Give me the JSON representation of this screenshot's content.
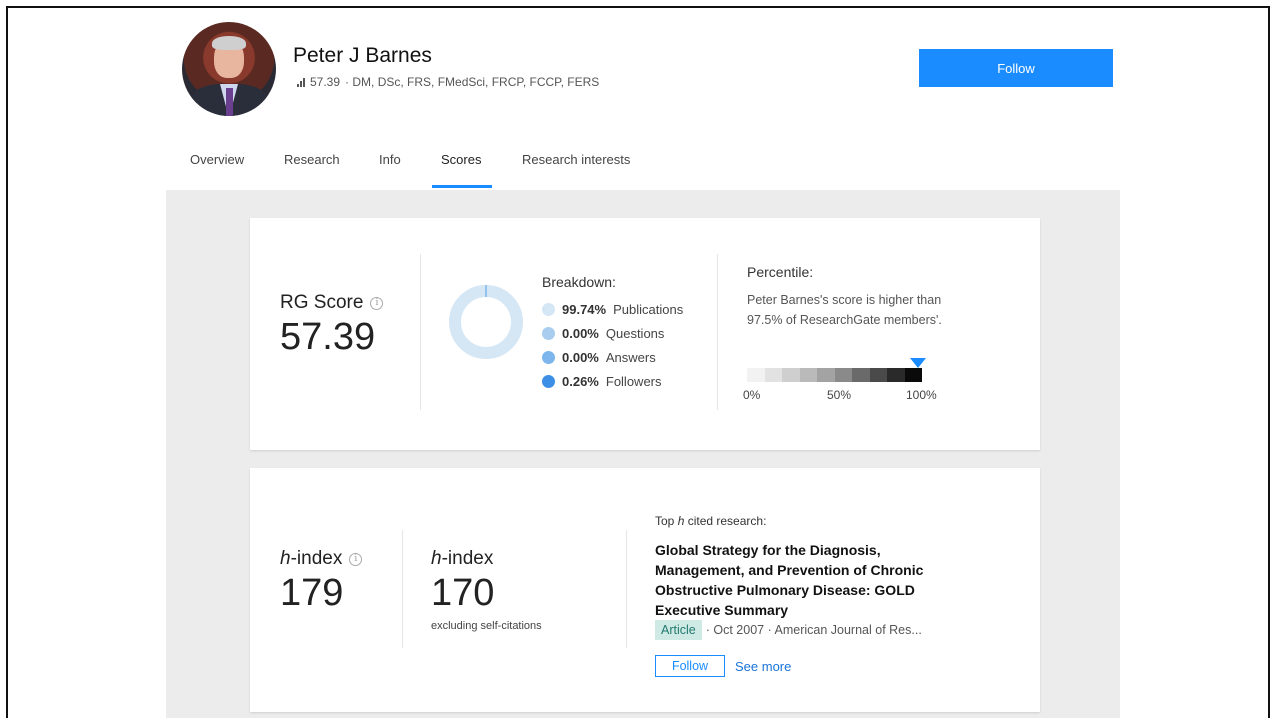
{
  "profile": {
    "name": "Peter J Barnes",
    "score": "57.39",
    "credentials": "· DM, DSc, FRS, FMedSci, FRCP, FCCP, FERS",
    "follow_label": "Follow"
  },
  "tabs": [
    {
      "label": "Overview"
    },
    {
      "label": "Research"
    },
    {
      "label": "Info"
    },
    {
      "label": "Scores"
    },
    {
      "label": "Research interests"
    }
  ],
  "active_tab": "Scores",
  "rg_card": {
    "label": "RG Score",
    "value": "57.39",
    "breakdown_title": "Breakdown:",
    "breakdown": [
      {
        "pct": "99.74%",
        "label": "Publications",
        "fraction": 0.9974,
        "color": "#d5e6f5"
      },
      {
        "pct": "0.00%",
        "label": "Questions",
        "fraction": 0.0,
        "color": "#a9cdef"
      },
      {
        "pct": "0.00%",
        "label": "Answers",
        "fraction": 0.0,
        "color": "#7db6ec"
      },
      {
        "pct": "0.26%",
        "label": "Followers",
        "fraction": 0.0026,
        "color": "#3d8fe6"
      }
    ],
    "percentile_title": "Percentile:",
    "percentile_text": "Peter Barnes's score is higher than 97.5% of ResearchGate members'.",
    "percentile_value": 97.5,
    "percentile_ticks": [
      "0%",
      "50%",
      "100%"
    ]
  },
  "h_card": {
    "h_label": "h",
    "h_suffix": "-index",
    "h_value": "179",
    "h2_value": "170",
    "h2_sub": "excluding self-citations",
    "top_prefix": "Top ",
    "top_italic": "h",
    "top_suffix": " cited research:",
    "paper_title": "Global Strategy for the Diagnosis, Management, and Prevention of Chronic Obstructive Pulmonary Disease: GOLD Executive Summary",
    "badge": "Article",
    "meta": "· Oct 2007 · American Journal of Res...",
    "follow_label": "Follow",
    "see_more": "See more"
  }
}
